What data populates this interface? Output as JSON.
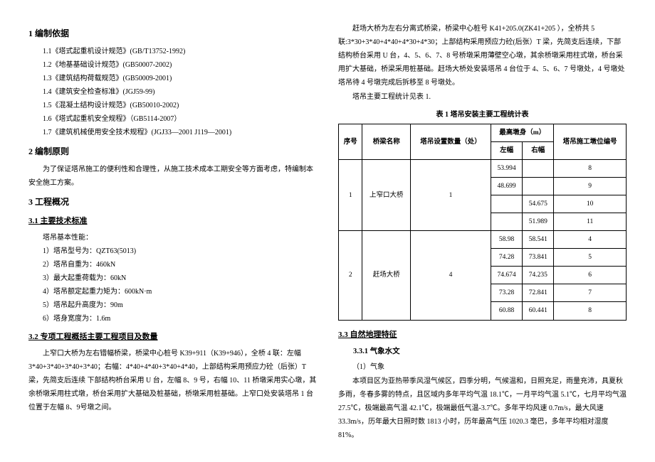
{
  "sec1": {
    "title": "1 编制依据",
    "items": [
      "1.1《塔式起重机设计规范》(GB/T13752-1992)",
      "1.2《地基基础设计规范》(GB50007-2002)",
      "1.3《建筑结构荷载规范》(GB50009-2001)",
      "1.4《建筑安全检查标准》(JGJ59-99)",
      "1.5《混凝土结构设计规范》(GB50010-2002)",
      "1.6《塔式起重机安全规程》（GB5114-2007）",
      "1.7《建筑机械使用安全技术规程》(JGJ33—2001 J119—2001)"
    ]
  },
  "sec2": {
    "title": "2 编制原则",
    "text": "为了保证塔吊施工的便利性和合理性，从施工技术成本工期安全等方面考虑，特编制本安全施工方案。"
  },
  "sec3": {
    "title": "3 工程概况"
  },
  "sec31": {
    "title": "3.1 主要技术标准",
    "lead": "塔吊基本性能：",
    "items": [
      "1）塔吊型号为：QZT63(5013)",
      "2）塔吊自重为：460kN",
      "3）最大起重荷载为：60kN",
      "4）塔吊额定起重力矩为：600kN·m",
      "5）塔吊起升高度为：90m",
      "6）塔身宽度为：1.6m"
    ]
  },
  "sec32": {
    "title": "3.2 专项工程概括主要工程项目及数量",
    "p1": "上窄口大桥为左右错幅桥梁，桥梁中心桩号 K39+911（K39+946），全桥 4 联：左幅3*40+3*40+3*40+3*40；右幅：4*40+4*40+3*40+4*40，上部结构采用预应力砼（后张）T 梁，先简支后连续 下部结构桥台采用 U 台，左幅 8、9 号，右幅 10、11 桥墩采用实心墩，其余桥墩采用柱式墩，桥台采用扩大基础及桩基础，桥墩采用桩基础。上窄口处安装塔吊 1 台位置于左幅 8、9号墩之间。",
    "p2": "赶场大桥为左右分离式桥梁，桥梁中心桩号 K41+205.0(ZK41+205 ），全桥共 5联:3*30+3*40+4*40+4*30+4*30；上部结构采用预应力砼(后张）T 梁，先简支后连续，下部结构桥台采用 U 台，4、5、6、7、8 号桥墩采用薄壁空心墩，其余桥墩采用柱式墩，桥台采用扩大基础，桥梁采用桩基础。赶场大桥处安装塔吊 4 台位于 4、5、6、7 号墩处，4 号墩处塔吊待 4 号墩完成后拆移至 8 号墩处。",
    "p3": "塔吊主要工程统计见表 1."
  },
  "table": {
    "caption": "表 1 塔吊安装主要工程统计表",
    "headers": [
      "序号",
      "桥梁名称",
      "塔吊设置数量（处）",
      "最高墩身（m）",
      "塔吊施工墩位编号"
    ],
    "subheaders": [
      "左幅",
      "右幅"
    ],
    "rows": [
      {
        "seq": "1",
        "name": "上窄口大桥",
        "qty": "1",
        "r": [
          [
            "53.994",
            "",
            "8"
          ],
          [
            "48.699",
            "",
            "9"
          ],
          [
            "",
            "54.675",
            "10"
          ],
          [
            "",
            "51.989",
            "11"
          ]
        ]
      },
      {
        "seq": "2",
        "name": "赶场大桥",
        "qty": "4",
        "r": [
          [
            "58.98",
            "58.541",
            "4"
          ],
          [
            "74.28",
            "73.841",
            "5"
          ],
          [
            "74.674",
            "74.235",
            "6"
          ],
          [
            "73.28",
            "72.841",
            "7"
          ],
          [
            "60.88",
            "60.441",
            "8"
          ]
        ]
      }
    ]
  },
  "sec33": {
    "title": "3.3 自然地理特征",
    "subtitle": "3.3.1 气象水文",
    "lead": "（1）气象",
    "p1": "本项目区为亚热带季风湿气候区，四季分明，气候温和，日照充足，雨量充沛，具夏秋多雨，冬春多雾的特点，且区域内多年平均气温 18.1℃，一月平均气温 5.1℃，七月平均气温 27.5℃，极端最高气温 42.1℃，极端最低气温-3.7℃。多年平均风速 0.7m/s，最大风速 33.3m/s，历年最大日照时数 1813 小时，历年最高气压 1020.3 毫巴，多年平均相对湿度 81%。"
  }
}
